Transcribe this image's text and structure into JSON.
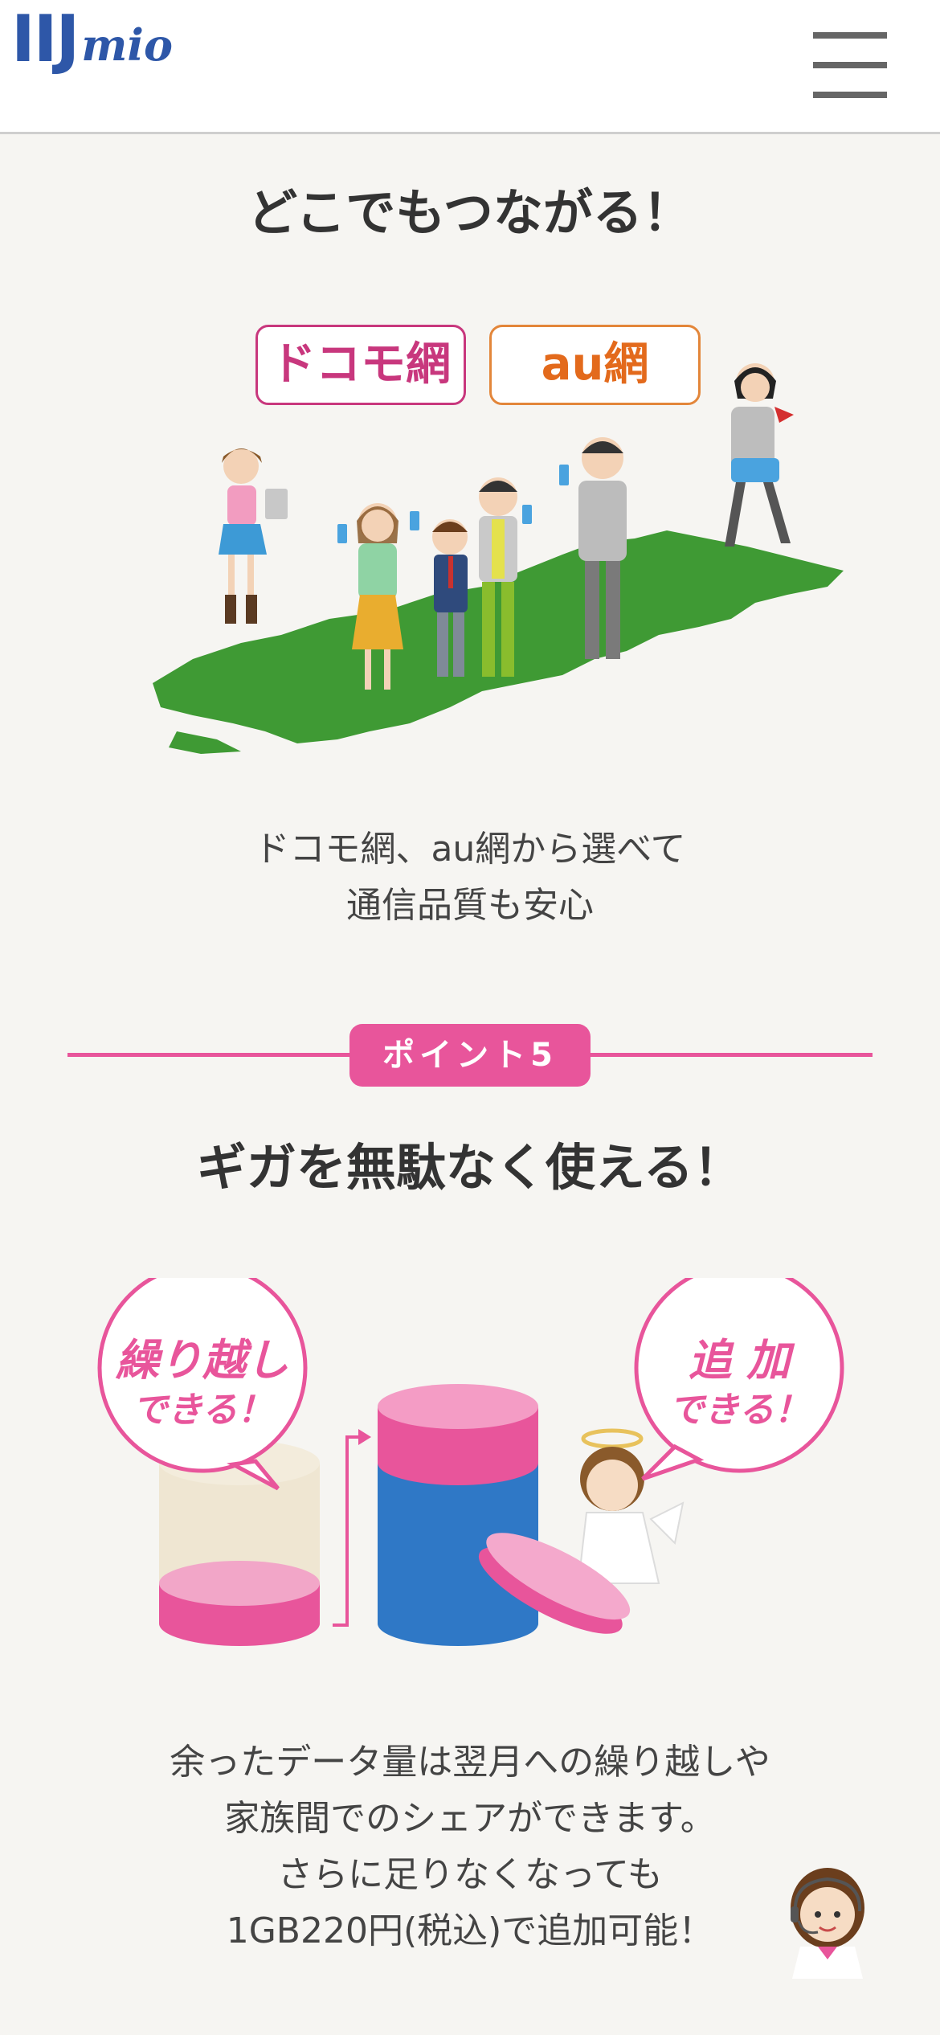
{
  "header": {
    "logo_big": "IIJ",
    "logo_small": "mio",
    "menu_icon": "hamburger-menu-icon"
  },
  "section_network": {
    "title": "どこでもつながる！",
    "badge_docomo": "ドコモ網",
    "badge_au": "au網",
    "caption_line1": "ドコモ網、au網から選べて",
    "caption_line2": "通信品質も安心"
  },
  "section_point5": {
    "point_label": "ポイント5",
    "title": "ギガを無駄なく使える！",
    "bubble_left_line1": "繰り越し",
    "bubble_left_line2": "できる！",
    "bubble_right_line1": "追 加",
    "bubble_right_line2": "できる！",
    "caption_line1": "余ったデータ量は翌月への繰り越しや",
    "caption_line2": "家族間でのシェアができます。",
    "caption_line3": "さらに足りなくなっても",
    "caption_line4": "1GB220円(税込)で追加可能！"
  },
  "colors": {
    "brand_blue": "#2e57a8",
    "accent_pink": "#e8559b",
    "docomo": "#c8377d",
    "au": "#e36a1c",
    "map_green": "#3f9a34"
  },
  "icons": {
    "support": "support-operator-icon"
  }
}
